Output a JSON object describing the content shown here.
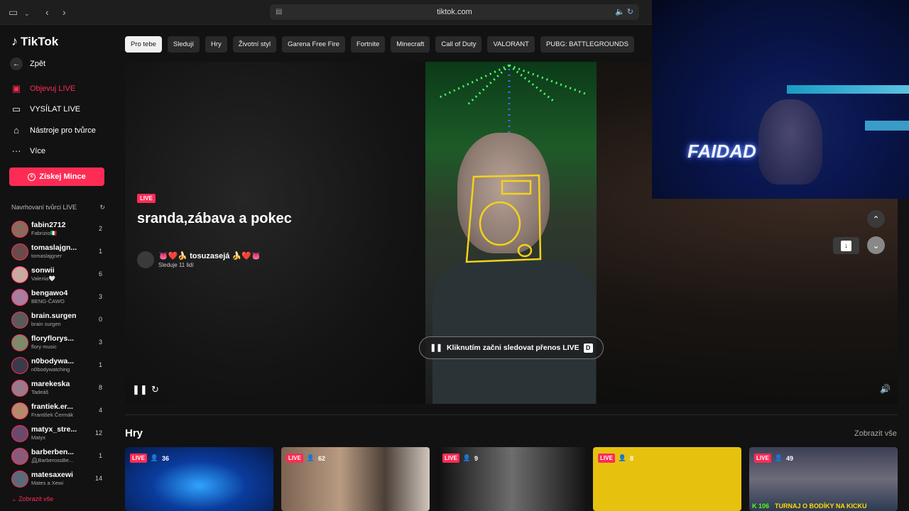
{
  "browser": {
    "url": "tiktok.com"
  },
  "sidebar": {
    "logo": "TikTok",
    "back": "Zpět",
    "nav": [
      {
        "label": "Objevuj LIVE",
        "icon": "live-icon",
        "active": true
      },
      {
        "label": "VYSÍLAT LIVE",
        "icon": "camera-icon",
        "active": false
      },
      {
        "label": "Nástroje pro tvůrce",
        "icon": "creator-tools-icon",
        "active": false
      },
      {
        "label": "Více",
        "icon": "more-icon",
        "active": false
      }
    ],
    "coins_button": "Získej Mince",
    "suggest_heading": "Navrhovaní tvůrci LIVE",
    "creators": [
      {
        "name": "fabin2712",
        "sub": "Fabrizio🇮🇹",
        "count": "2"
      },
      {
        "name": "tomaslajgn...",
        "sub": "tomaslajgner",
        "count": "1"
      },
      {
        "name": "sonwii",
        "sub": "Valeriia🤍",
        "count": "6"
      },
      {
        "name": "bengawo4",
        "sub": "BENG-ČAWO",
        "count": "3"
      },
      {
        "name": "brain.surgen",
        "sub": "brain surgen",
        "count": "0"
      },
      {
        "name": "floryflorys...",
        "sub": "flory music",
        "count": "3"
      },
      {
        "name": "n0bodywa...",
        "sub": "n0bodywatching",
        "count": "1"
      },
      {
        "name": "marekeska",
        "sub": "Tadeáš",
        "count": "8"
      },
      {
        "name": "frantiek.er...",
        "sub": "František Čermák",
        "count": "4"
      },
      {
        "name": "matyx_stre...",
        "sub": "Matyx",
        "count": "12"
      },
      {
        "name": "barberben...",
        "sub": "🕰BarberossBe...",
        "count": "1"
      },
      {
        "name": "matesaxewi",
        "sub": "Mates a Xewi",
        "count": "14"
      }
    ],
    "show_all": "Zobrazit vše"
  },
  "chips": [
    "Pro tebe",
    "Sledují",
    "Hry",
    "Životní styl",
    "Garena Free Fire",
    "Fortnite",
    "Minecraft",
    "Call of Duty",
    "VALORANT",
    "PUBG: BATTLEGROUNDS"
  ],
  "player": {
    "live_badge": "LIVE",
    "title": "sranda,zábava a pokec",
    "host_name": "👅❤️🍌 tosuzasejá 🍌❤️👅",
    "viewers": "Sleduje 11 lidí",
    "cta": "Kliknutím začni sledovat přenos LIVE",
    "cta_key": "D"
  },
  "pip": {
    "neon_text": "FAIDAD"
  },
  "section": {
    "title": "Hry",
    "link": "Zobrazit vše",
    "cards": [
      {
        "badge": "LIVE",
        "viewers": "36"
      },
      {
        "badge": "LIVE",
        "viewers": "62"
      },
      {
        "badge": "LIVE",
        "viewers": "9"
      },
      {
        "badge": "LIVE",
        "viewers": "8"
      },
      {
        "badge": "LIVE",
        "viewers": "49",
        "k_count": "106",
        "banner": "TURNAJ O BODÍKY NA KICKU"
      }
    ]
  }
}
